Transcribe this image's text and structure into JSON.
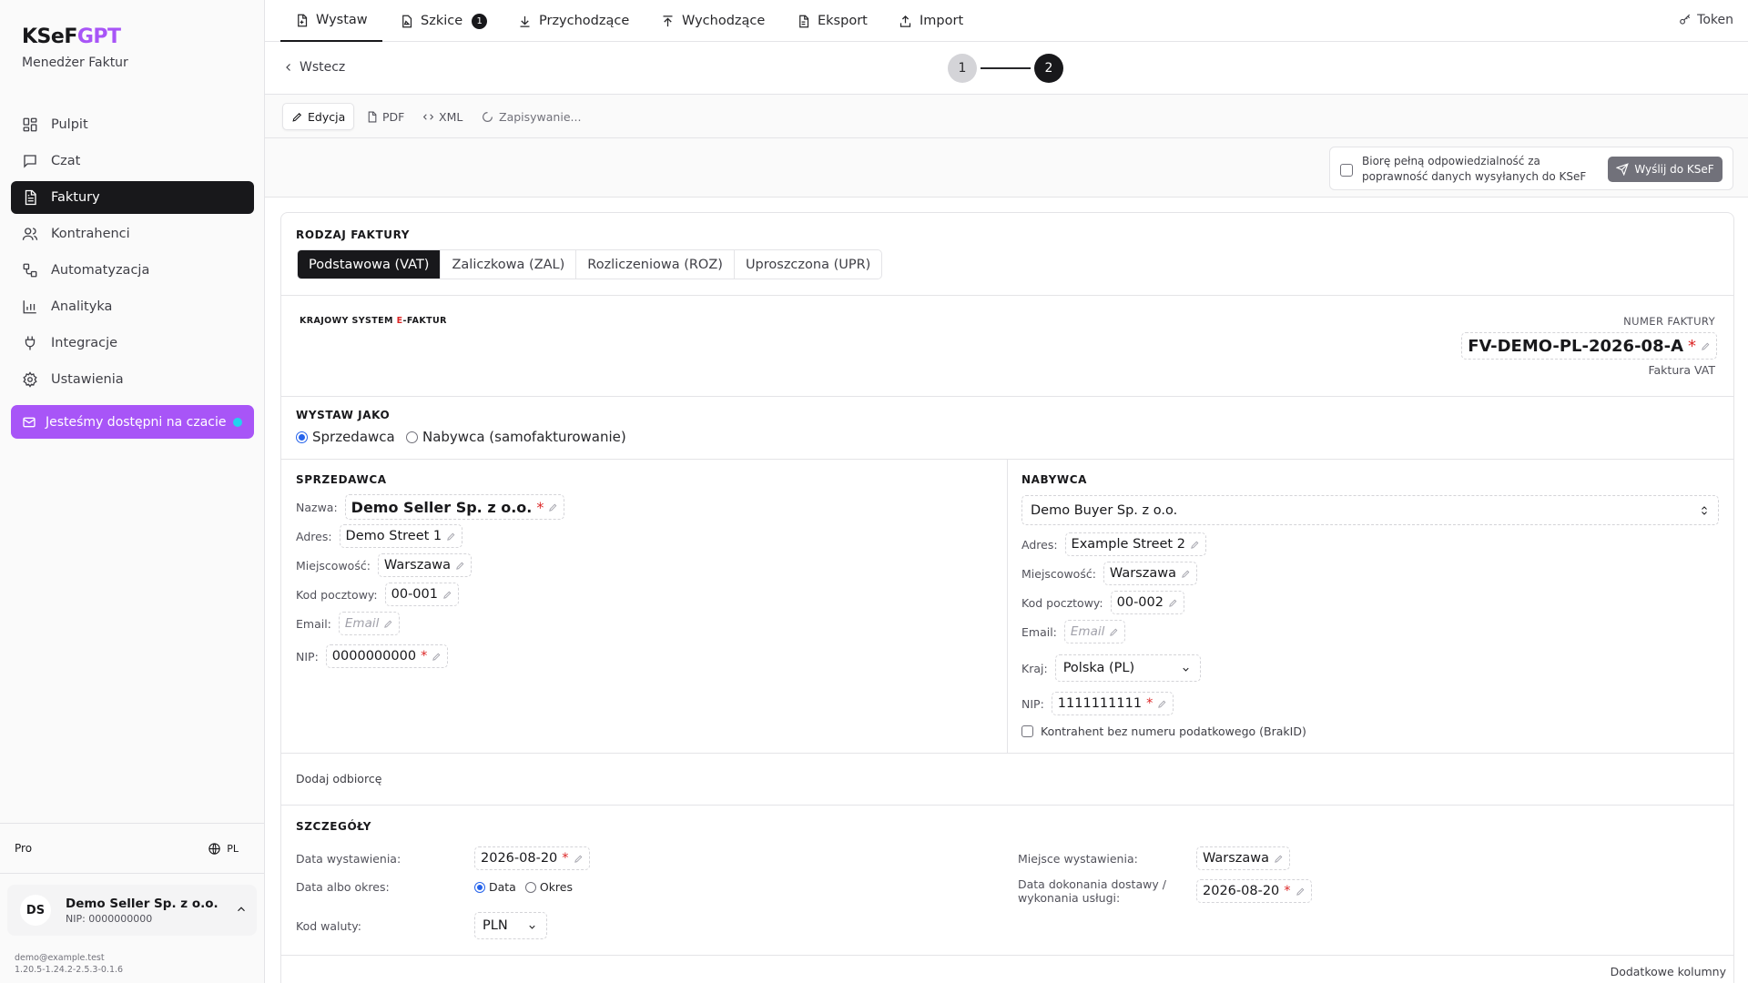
{
  "brand": {
    "name_main": "KSeF",
    "name_accent": "GPT",
    "subtitle": "Menedżer Faktur"
  },
  "sidebar": {
    "items": [
      {
        "label": "Pulpit",
        "icon": "dashboard-icon"
      },
      {
        "label": "Czat",
        "icon": "chat-icon"
      },
      {
        "label": "Faktury",
        "icon": "invoice-icon",
        "active": true
      },
      {
        "label": "Kontrahenci",
        "icon": "users-icon"
      },
      {
        "label": "Automatyzacja",
        "icon": "workflow-icon"
      },
      {
        "label": "Analityka",
        "icon": "chart-icon"
      },
      {
        "label": "Integracje",
        "icon": "plug-icon"
      },
      {
        "label": "Ustawienia",
        "icon": "gear-icon"
      }
    ],
    "chat_cta": "Jesteśmy dostępni na czacie",
    "plan": "Pro",
    "language": "PL",
    "user": {
      "initials": "DS",
      "name": "Demo Seller Sp. z o.o.",
      "nip": "NIP: 0000000000"
    },
    "footer_email": "demo@example.test",
    "footer_version": "1.20.5-1.24.2-2.5.3-0.1.6"
  },
  "topbar": {
    "tabs": [
      {
        "label": "Wystaw",
        "icon": "document-plus-icon",
        "active": true
      },
      {
        "label": "Szkice",
        "icon": "draft-icon",
        "badge": "1"
      },
      {
        "label": "Przychodzące",
        "icon": "download-icon"
      },
      {
        "label": "Wychodzące",
        "icon": "upload-icon"
      },
      {
        "label": "Eksport",
        "icon": "file-export-icon"
      },
      {
        "label": "Import",
        "icon": "import-icon"
      }
    ],
    "token_label": "Token"
  },
  "wizard": {
    "back_label": "Wstecz",
    "step1": "1",
    "step2": "2",
    "current_step": 2
  },
  "modes": {
    "edit": "Edycja",
    "pdf": "PDF",
    "xml": "XML",
    "saving": "Zapisywanie..."
  },
  "confirm": {
    "text": "Biorę pełną odpowiedzialność za poprawność danych wysyłanych do KSeF",
    "checked": false,
    "send_label": "Wyślij do KSeF"
  },
  "invoice_type": {
    "title": "RODZAJ FAKTURY",
    "options": [
      "Podstawowa (VAT)",
      "Zaliczkowa (ZAL)",
      "Rozliczeniowa (ROZ)",
      "Uproszczona (UPR)"
    ],
    "selected": "Podstawowa (VAT)"
  },
  "header": {
    "logo_part1": "KRAJOWY SYSTEM ",
    "logo_part2": "E",
    "logo_part3": "-FAKTUR",
    "number_label": "NUMER FAKTURY",
    "number": "FV-DEMO-PL-2026-08-A",
    "type_label": "Faktura VAT"
  },
  "issue_as": {
    "title": "WYSTAW JAKO",
    "seller": "Sprzedawca",
    "buyer": "Nabywca (samofakturowanie)",
    "selected": "Sprzedawca"
  },
  "seller": {
    "title": "SPRZEDAWCA",
    "name_label": "Nazwa:",
    "name": "Demo Seller Sp. z o.o.",
    "address_label": "Adres:",
    "address": "Demo Street 1",
    "city_label": "Miejscowość:",
    "city": "Warszawa",
    "postal_label": "Kod pocztowy:",
    "postal": "00-001",
    "email_label": "Email:",
    "email_placeholder": "Email",
    "nip_label": "NIP:",
    "nip": "0000000000"
  },
  "buyer": {
    "title": "NABYWCA",
    "selected": "Demo Buyer Sp. z o.o.",
    "address_label": "Adres:",
    "address": "Example Street 2",
    "city_label": "Miejscowość:",
    "city": "Warszawa",
    "postal_label": "Kod pocztowy:",
    "postal": "00-002",
    "email_label": "Email:",
    "email_placeholder": "Email",
    "country_label": "Kraj:",
    "country": "Polska (PL)",
    "nip_label": "NIP:",
    "nip": "1111111111",
    "no_tax_id_label": "Kontrahent bez numeru podatkowego (BrakID)"
  },
  "add_recipient": "Dodaj odbiorcę",
  "details": {
    "title": "SZCZEGÓŁY",
    "issue_date_label": "Data wystawienia:",
    "issue_date": "2026-08-20",
    "date_or_period_label": "Data albo okres:",
    "opt_date": "Data",
    "opt_period": "Okres",
    "selected": "Data",
    "currency_label": "Kod waluty:",
    "currency": "PLN",
    "place_label": "Miejsce wystawienia:",
    "place": "Warszawa",
    "delivery_label_1": "Data dokonania dostawy /",
    "delivery_label_2": "wykonania usługi:",
    "delivery_date": "2026-08-20",
    "extra_columns": "Dodatkowe kolumny"
  }
}
